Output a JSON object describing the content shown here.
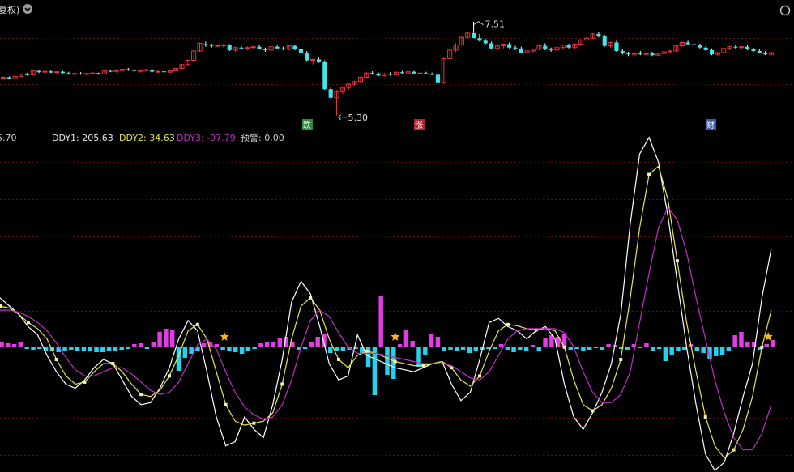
{
  "header": {
    "title_fragment": "复权)",
    "menu_icon": "chevron-down-circle-icon"
  },
  "colors": {
    "background": "#000000",
    "up_candle": "#e8323c",
    "down_candle": "#3fe6ea",
    "white_line": "#ffffff",
    "yellow_line": "#e6e64a",
    "magenta_line": "#c02ec4",
    "pos_bar": "#e33be6",
    "neg_bar": "#22d3f0",
    "star": "#f5b524",
    "grid": "#5a1010",
    "divider": "#6a1818"
  },
  "price_panel": {
    "high_label": "7.51",
    "low_label": "5.30",
    "markers": [
      {
        "text": "跌",
        "kind": "down",
        "color": "#2e8b3e"
      },
      {
        "text": "涨",
        "kind": "up",
        "color": "#b02530"
      },
      {
        "text": "财",
        "kind": "info",
        "color": "#3a5aa8"
      }
    ]
  },
  "indicator_header": {
    "left_value": "5.70",
    "ddy1_label": "DDY1: 205.63",
    "ddy2_label": "DDY2: 34.63",
    "ddy3_label": "DDY3: -97.79",
    "alert_label": "预警: 0.00"
  },
  "chart_data": [
    {
      "type": "candlestick",
      "title": "",
      "ylim": [
        5.2,
        7.6
      ],
      "annotations": [
        {
          "label": "7.51",
          "at_index": 79
        },
        {
          "label": "5.30",
          "at_index": 56
        }
      ],
      "ohlc": [
        [
          6.18,
          6.22,
          6.14,
          6.2
        ],
        [
          6.2,
          6.22,
          6.16,
          6.17
        ],
        [
          6.17,
          6.24,
          6.15,
          6.22
        ],
        [
          6.22,
          6.28,
          6.2,
          6.27
        ],
        [
          6.27,
          6.3,
          6.24,
          6.26
        ],
        [
          6.26,
          6.36,
          6.25,
          6.35
        ],
        [
          6.35,
          6.38,
          6.3,
          6.32
        ],
        [
          6.32,
          6.36,
          6.29,
          6.34
        ],
        [
          6.34,
          6.36,
          6.3,
          6.31
        ],
        [
          6.31,
          6.34,
          6.28,
          6.33
        ],
        [
          6.33,
          6.35,
          6.29,
          6.3
        ],
        [
          6.3,
          6.33,
          6.26,
          6.28
        ],
        [
          6.28,
          6.31,
          6.25,
          6.29
        ],
        [
          6.29,
          6.32,
          6.26,
          6.27
        ],
        [
          6.27,
          6.3,
          6.25,
          6.29
        ],
        [
          6.29,
          6.32,
          6.27,
          6.3
        ],
        [
          6.3,
          6.31,
          6.26,
          6.28
        ],
        [
          6.28,
          6.36,
          6.27,
          6.35
        ],
        [
          6.35,
          6.38,
          6.32,
          6.34
        ],
        [
          6.34,
          6.37,
          6.31,
          6.36
        ],
        [
          6.36,
          6.4,
          6.34,
          6.39
        ],
        [
          6.39,
          6.42,
          6.35,
          6.37
        ],
        [
          6.37,
          6.4,
          6.33,
          6.35
        ],
        [
          6.35,
          6.38,
          6.31,
          6.36
        ],
        [
          6.36,
          6.4,
          6.34,
          6.38
        ],
        [
          6.38,
          6.4,
          6.32,
          6.33
        ],
        [
          6.33,
          6.36,
          6.3,
          6.34
        ],
        [
          6.34,
          6.37,
          6.31,
          6.32
        ],
        [
          6.32,
          6.36,
          6.3,
          6.35
        ],
        [
          6.35,
          6.42,
          6.34,
          6.41
        ],
        [
          6.41,
          6.52,
          6.4,
          6.5
        ],
        [
          6.5,
          6.62,
          6.48,
          6.6
        ],
        [
          6.6,
          6.84,
          6.58,
          6.82
        ],
        [
          6.82,
          7.02,
          6.8,
          7.0
        ],
        [
          6.98,
          7.04,
          6.92,
          6.96
        ],
        [
          6.96,
          6.99,
          6.9,
          6.94
        ],
        [
          6.94,
          6.98,
          6.91,
          6.95
        ],
        [
          6.95,
          6.99,
          6.9,
          6.96
        ],
        [
          6.96,
          6.98,
          6.82,
          6.84
        ],
        [
          6.84,
          6.92,
          6.8,
          6.9
        ],
        [
          6.9,
          6.94,
          6.86,
          6.88
        ],
        [
          6.88,
          6.93,
          6.84,
          6.9
        ],
        [
          6.9,
          6.94,
          6.86,
          6.92
        ],
        [
          6.92,
          6.96,
          6.86,
          6.87
        ],
        [
          6.87,
          6.9,
          6.8,
          6.84
        ],
        [
          6.84,
          6.94,
          6.82,
          6.92
        ],
        [
          6.92,
          6.95,
          6.86,
          6.88
        ],
        [
          6.88,
          6.92,
          6.84,
          6.86
        ],
        [
          6.86,
          6.96,
          6.84,
          6.94
        ],
        [
          6.94,
          6.96,
          6.84,
          6.86
        ],
        [
          6.86,
          6.9,
          6.76,
          6.78
        ],
        [
          6.78,
          6.82,
          6.58,
          6.6
        ],
        [
          6.6,
          6.64,
          6.5,
          6.62
        ],
        [
          6.62,
          6.66,
          6.54,
          6.56
        ],
        [
          6.56,
          6.6,
          5.9,
          5.92
        ],
        [
          5.92,
          5.96,
          5.7,
          5.72
        ],
        [
          5.72,
          5.9,
          5.3,
          5.86
        ],
        [
          5.86,
          5.98,
          5.8,
          5.96
        ],
        [
          5.96,
          6.06,
          5.9,
          6.04
        ],
        [
          6.04,
          6.12,
          6.0,
          6.1
        ],
        [
          6.1,
          6.22,
          6.08,
          6.2
        ],
        [
          6.2,
          6.32,
          6.18,
          6.3
        ],
        [
          6.3,
          6.34,
          6.26,
          6.29
        ],
        [
          6.29,
          6.32,
          6.22,
          6.24
        ],
        [
          6.24,
          6.3,
          6.22,
          6.28
        ],
        [
          6.28,
          6.32,
          6.24,
          6.26
        ],
        [
          6.26,
          6.33,
          6.24,
          6.32
        ],
        [
          6.32,
          6.35,
          6.28,
          6.3
        ],
        [
          6.3,
          6.34,
          6.28,
          6.33
        ],
        [
          6.33,
          6.35,
          6.28,
          6.29
        ],
        [
          6.29,
          6.32,
          6.26,
          6.3
        ],
        [
          6.3,
          6.33,
          6.27,
          6.28
        ],
        [
          6.28,
          6.31,
          6.25,
          6.26
        ],
        [
          6.26,
          6.3,
          6.05,
          6.08
        ],
        [
          6.08,
          6.66,
          6.06,
          6.64
        ],
        [
          6.64,
          6.86,
          6.62,
          6.84
        ],
        [
          6.84,
          7.0,
          6.8,
          6.96
        ],
        [
          6.96,
          7.16,
          6.94,
          7.14
        ],
        [
          7.14,
          7.26,
          7.1,
          7.24
        ],
        [
          7.24,
          7.51,
          7.2,
          7.12
        ],
        [
          7.12,
          7.22,
          7.04,
          7.06
        ],
        [
          7.06,
          7.1,
          6.98,
          7.0
        ],
        [
          7.0,
          7.04,
          6.86,
          6.88
        ],
        [
          6.88,
          6.96,
          6.84,
          6.94
        ],
        [
          6.94,
          7.0,
          6.88,
          6.98
        ],
        [
          6.98,
          7.02,
          6.88,
          6.9
        ],
        [
          6.9,
          6.94,
          6.84,
          6.88
        ],
        [
          6.88,
          6.92,
          6.76,
          6.78
        ],
        [
          6.78,
          6.84,
          6.74,
          6.82
        ],
        [
          6.82,
          6.88,
          6.78,
          6.86
        ],
        [
          6.86,
          6.96,
          6.84,
          6.94
        ],
        [
          6.94,
          7.0,
          6.84,
          6.86
        ],
        [
          6.86,
          6.9,
          6.8,
          6.84
        ],
        [
          6.84,
          6.92,
          6.8,
          6.9
        ],
        [
          6.9,
          6.98,
          6.86,
          6.96
        ],
        [
          6.96,
          6.99,
          6.88,
          6.9
        ],
        [
          6.9,
          7.0,
          6.88,
          6.98
        ],
        [
          6.98,
          7.1,
          6.96,
          7.08
        ],
        [
          7.08,
          7.14,
          7.04,
          7.12
        ],
        [
          7.12,
          7.24,
          7.1,
          7.22
        ],
        [
          7.22,
          7.26,
          7.14,
          7.16
        ],
        [
          7.16,
          7.2,
          6.92,
          6.94
        ],
        [
          6.94,
          7.04,
          6.9,
          7.02
        ],
        [
          7.02,
          7.06,
          6.8,
          6.82
        ],
        [
          6.82,
          6.86,
          6.74,
          6.76
        ],
        [
          6.76,
          6.8,
          6.7,
          6.74
        ],
        [
          6.74,
          6.78,
          6.7,
          6.76
        ],
        [
          6.76,
          6.82,
          6.72,
          6.74
        ],
        [
          6.74,
          6.78,
          6.72,
          6.76
        ],
        [
          6.76,
          6.8,
          6.7,
          6.72
        ],
        [
          6.72,
          6.78,
          6.7,
          6.76
        ],
        [
          6.76,
          6.82,
          6.74,
          6.8
        ],
        [
          6.8,
          6.84,
          6.76,
          6.82
        ],
        [
          6.82,
          6.96,
          6.8,
          6.94
        ],
        [
          6.94,
          7.04,
          6.92,
          7.02
        ],
        [
          7.02,
          7.06,
          6.96,
          6.98
        ],
        [
          6.98,
          7.02,
          6.92,
          6.96
        ],
        [
          6.96,
          6.99,
          6.88,
          6.9
        ],
        [
          6.9,
          6.94,
          6.82,
          6.84
        ],
        [
          6.84,
          6.88,
          6.72,
          6.74
        ],
        [
          6.74,
          6.8,
          6.7,
          6.78
        ],
        [
          6.78,
          6.9,
          6.76,
          6.88
        ],
        [
          6.88,
          6.94,
          6.84,
          6.92
        ],
        [
          6.92,
          6.96,
          6.86,
          6.9
        ],
        [
          6.9,
          6.94,
          6.86,
          6.92
        ],
        [
          6.92,
          6.96,
          6.84,
          6.86
        ],
        [
          6.86,
          6.9,
          6.8,
          6.82
        ],
        [
          6.82,
          6.86,
          6.76,
          6.78
        ],
        [
          6.78,
          6.82,
          6.72,
          6.74
        ],
        [
          6.74,
          6.8,
          6.72,
          6.78
        ]
      ]
    },
    {
      "type": "line",
      "title": "",
      "series": [
        {
          "name": "DDY1",
          "color": "#ffffff",
          "values": [
            60,
            40,
            20,
            -10,
            -30,
            -80,
            -120,
            -150,
            -160,
            -140,
            -110,
            -90,
            -100,
            -140,
            -180,
            -200,
            -195,
            -160,
            -110,
            -40,
            5,
            -20,
            -120,
            -230,
            -300,
            -290,
            -230,
            -260,
            -280,
            -200,
            -90,
            50,
            100,
            70,
            -10,
            -100,
            -140,
            -130,
            -30,
            -80,
            -90,
            -100,
            -110,
            -115,
            -120,
            -110,
            -100,
            -95,
            -150,
            -190,
            -170,
            -90,
            0,
            10,
            -10,
            -20,
            -40,
            -20,
            -10,
            -40,
            -150,
            -230,
            -260,
            -220,
            -170,
            -100,
            20,
            240,
            410,
            450,
            390,
            260,
            100,
            -60,
            -200,
            -320,
            -360,
            -340,
            -270,
            -180,
            -100,
            60,
            180
          ]
        },
        {
          "name": "DDY2",
          "color": "#e6e64a",
          "values": [
            40,
            35,
            20,
            0,
            -15,
            -40,
            -90,
            -130,
            -150,
            -145,
            -120,
            -100,
            -100,
            -120,
            -150,
            -175,
            -180,
            -165,
            -130,
            -80,
            -20,
            -5,
            -40,
            -120,
            -200,
            -240,
            -250,
            -245,
            -240,
            -220,
            -150,
            -40,
            40,
            60,
            30,
            -40,
            -90,
            -110,
            -80,
            -70,
            -75,
            -85,
            -95,
            -100,
            -105,
            -105,
            -100,
            -95,
            -110,
            -140,
            -155,
            -130,
            -70,
            -20,
            -5,
            -8,
            -15,
            -18,
            -15,
            -20,
            -60,
            -140,
            -200,
            -215,
            -200,
            -160,
            -90,
            60,
            230,
            360,
            380,
            300,
            150,
            0,
            -120,
            -230,
            -300,
            -330,
            -310,
            -260,
            -180,
            -60,
            30
          ]
        },
        {
          "name": "DDY3",
          "color": "#c02ec4",
          "values": [
            30,
            30,
            25,
            15,
            0,
            -20,
            -50,
            -85,
            -115,
            -130,
            -130,
            -120,
            -110,
            -110,
            -125,
            -145,
            -165,
            -175,
            -170,
            -145,
            -100,
            -55,
            -40,
            -65,
            -120,
            -170,
            -205,
            -225,
            -235,
            -230,
            -200,
            -140,
            -60,
            5,
            30,
            15,
            -25,
            -60,
            -75,
            -75,
            -75,
            -80,
            -85,
            -90,
            -95,
            -100,
            -100,
            -100,
            -105,
            -120,
            -135,
            -140,
            -120,
            -80,
            -40,
            -20,
            -15,
            -15,
            -15,
            -15,
            -25,
            -60,
            -120,
            -170,
            -195,
            -195,
            -175,
            -120,
            0,
            120,
            230,
            280,
            250,
            170,
            60,
            -40,
            -140,
            -220,
            -280,
            -310,
            -310,
            -270,
            -200
          ]
        }
      ],
      "bars": [
        5,
        4,
        3,
        5,
        -3,
        -4,
        -3,
        -5,
        -6,
        -7,
        -5,
        -4,
        -6,
        -5,
        -6,
        -7,
        -7,
        -6,
        -5,
        -4,
        -3,
        3,
        4,
        -3,
        5,
        18,
        22,
        20,
        -30,
        -14,
        -9,
        -6,
        4,
        5,
        3,
        -4,
        -6,
        -7,
        -9,
        -5,
        -3,
        4,
        6,
        6,
        10,
        12,
        5,
        -4,
        -3,
        5,
        12,
        16,
        -8,
        -6,
        -5,
        -4,
        -3,
        -8,
        -25,
        -60,
        62,
        -35,
        -40,
        3,
        20,
        7,
        -25,
        -10,
        15,
        12,
        -5,
        -4,
        -6,
        -4,
        -8,
        -5,
        -4,
        -3,
        -3,
        3,
        -4,
        -7,
        -4,
        -5,
        2,
        -5,
        10,
        14,
        12,
        15,
        -4,
        -3,
        -5,
        -4,
        -2,
        -4,
        3,
        2,
        -3,
        -4,
        3,
        -2,
        4,
        -6,
        -3,
        -18,
        -10,
        -6,
        -4,
        3,
        -5,
        -8,
        -15,
        -12,
        -10,
        -5,
        14,
        18,
        5,
        6,
        -4,
        3,
        8
      ],
      "stars": [
        35,
        62,
        121,
        160
      ],
      "ylim": [
        -350,
        430
      ]
    }
  ]
}
